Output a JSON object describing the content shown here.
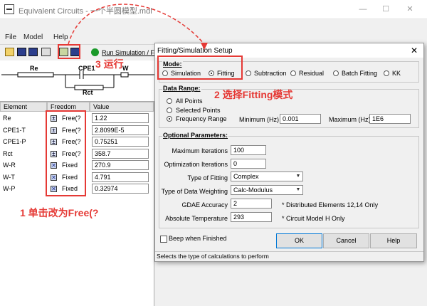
{
  "window": {
    "title": "Equivalent Circuits - 一个半圆模型.mdl",
    "minimize": "—",
    "maximize": "☐",
    "close": "✕"
  },
  "menu": [
    "File",
    "Model",
    "Help"
  ],
  "toolbar": {
    "run_label": "Run Simulation / F"
  },
  "circuit": {
    "labels": [
      "Re",
      "CPE1",
      "W",
      "Rct"
    ]
  },
  "table": {
    "headers": [
      "Element",
      "Freedom",
      "Value"
    ],
    "rows": [
      {
        "element": "Re",
        "freedom": "Free(?",
        "value": "1.22",
        "fixed": false
      },
      {
        "element": "CPE1-T",
        "freedom": "Free(?",
        "value": "2.8099E-5",
        "fixed": false
      },
      {
        "element": "CPE1-P",
        "freedom": "Free(?",
        "value": "0.75251",
        "fixed": false
      },
      {
        "element": "Rct",
        "freedom": "Free(?",
        "value": "358.7",
        "fixed": false
      },
      {
        "element": "W-R",
        "freedom": "Fixed",
        "value": "270.9",
        "fixed": true
      },
      {
        "element": "W-T",
        "freedom": "Fixed",
        "value": "4.791",
        "fixed": true
      },
      {
        "element": "W-P",
        "freedom": "Fixed",
        "value": "0.32974",
        "fixed": true
      }
    ]
  },
  "dialog": {
    "title": "Fitting/Simulation Setup",
    "close": "✕",
    "mode": {
      "label": "Mode:",
      "options": [
        "Simulation",
        "Fitting",
        "Subtraction",
        "Residual",
        "Batch Fitting",
        "KK"
      ],
      "selected": "Fitting"
    },
    "data_range": {
      "label": "Data Range:",
      "options": [
        "All Points",
        "Selected Points",
        "Frequency Range"
      ],
      "selected": "Frequency Range",
      "min_label": "Minimum (Hz)",
      "min_value": "0.001",
      "max_label": "Maximum (Hz)",
      "max_value": "1E6"
    },
    "optional": {
      "label": "Optional Parameters:",
      "max_iter_label": "Maximum Iterations",
      "max_iter_value": "100",
      "opt_iter_label": "Optimization Iterations",
      "opt_iter_value": "0",
      "type_fit_label": "Type of Fitting",
      "type_fit_value": "Complex",
      "weight_label": "Type of Data Weighting",
      "weight_value": "Calc-Modulus",
      "gdae_label": "GDAE Accuracy",
      "gdae_value": "2",
      "gdae_note": "* Distributed Elements 12,14 Only",
      "temp_label": "Absolute Temperature",
      "temp_value": "293",
      "temp_note": "* Circuit Model H Only"
    },
    "beep_label": "Beep when Finished",
    "ok": "OK",
    "cancel": "Cancel",
    "help": "Help",
    "status": "Selects the type of calculations to perform"
  },
  "annotations": {
    "step1": "1 单击改为Free(?",
    "step2": "2 选择Fitting模式",
    "step3": "3 运行"
  },
  "colors": {
    "annotation": "#e53935",
    "run_icon": "#1a9a2a"
  }
}
